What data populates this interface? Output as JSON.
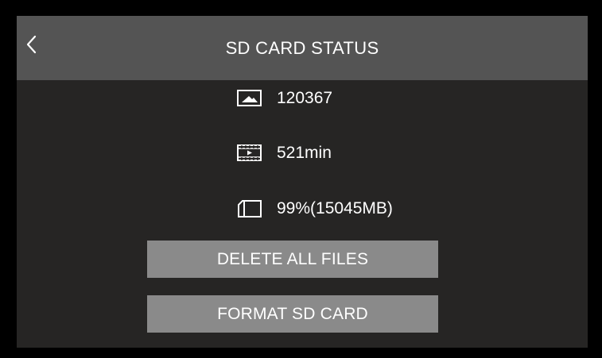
{
  "header": {
    "title": "SD CARD STATUS",
    "back_icon": "chevron-left-icon"
  },
  "stats": {
    "photos": {
      "icon": "image-icon",
      "value": "120367"
    },
    "video": {
      "icon": "film-icon",
      "value": "521min"
    },
    "storage": {
      "icon": "sd-card-icon",
      "value": "99%(15045MB)"
    }
  },
  "actions": {
    "delete_all_label": "DELETE ALL FILES",
    "format_label": "FORMAT SD CARD"
  },
  "colors": {
    "outer_frame": "#000000",
    "background": "#262524",
    "header": "#545454",
    "button": "#8a8a8a",
    "text": "#ffffff"
  }
}
